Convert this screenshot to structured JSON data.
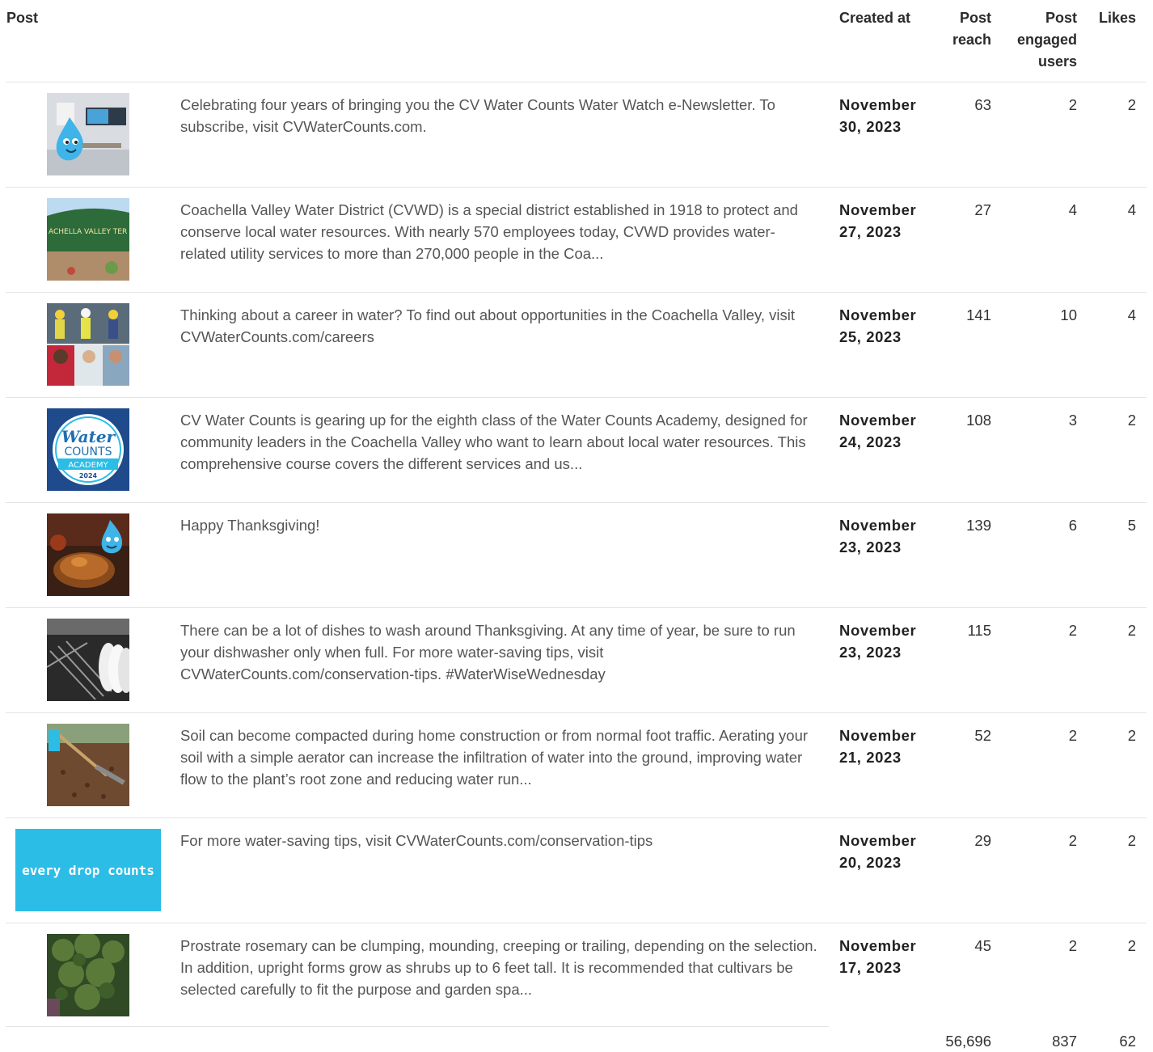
{
  "headers": {
    "post": "Post",
    "created_at": "Created at",
    "post_reach": "Post reach",
    "post_engaged_users": "Post engaged users",
    "likes": "Likes"
  },
  "rows": [
    {
      "thumb_icon": "water-drop-mascot-office-icon",
      "text": "Celebrating four years of bringing you the CV Water Counts Water Watch e-Newsletter. To subscribe, visit CVWaterCounts.com.",
      "date": "November 30, 2023",
      "reach": "63",
      "engaged": "2",
      "likes": "2"
    },
    {
      "thumb_icon": "district-sign-icon",
      "thumb_text": "ACHELLA VALLEY TER DISTRICT",
      "text": "Coachella Valley Water District (CVWD) is a special district established in 1918 to protect and conserve local water resources. With nearly 570 employees today, CVWD provides water-related utility services to more than 270,000 people in the Coa...",
      "date": "November 27, 2023",
      "reach": "27",
      "engaged": "4",
      "likes": "4"
    },
    {
      "thumb_icon": "workers-collage-icon",
      "text": "Thinking about a career in water? To find out about opportunities in the Coachella Valley, visit CVWaterCounts.com/careers",
      "date": "November 25, 2023",
      "reach": "141",
      "engaged": "10",
      "likes": "4"
    },
    {
      "thumb_icon": "water-counts-academy-logo-icon",
      "thumb_text": {
        "line1": "Water",
        "line2": "COUNTS",
        "line3": "ACADEMY",
        "line4": "2024"
      },
      "text": "CV Water Counts is gearing up for the eighth class of the Water Counts Academy, designed for community leaders in the Coachella Valley who want to learn about local water resources. This comprehensive course covers the different services and us...",
      "date": "November 24, 2023",
      "reach": "108",
      "engaged": "3",
      "likes": "2"
    },
    {
      "thumb_icon": "thanksgiving-turkey-icon",
      "text": "Happy Thanksgiving!",
      "date": "November 23, 2023",
      "reach": "139",
      "engaged": "6",
      "likes": "5"
    },
    {
      "thumb_icon": "dishwasher-icon",
      "text": "There can be a lot of dishes to wash around Thanksgiving. At any time of year, be sure to run your dishwasher only when full. For more water-saving tips, visit CVWaterCounts.com/conservation-tips. #WaterWiseWednesday",
      "date": "November 23, 2023",
      "reach": "115",
      "engaged": "2",
      "likes": "2"
    },
    {
      "thumb_icon": "soil-aerator-rake-icon",
      "text": "Soil can become compacted during home construction or from normal foot traffic. Aerating your soil with a simple aerator can increase the infiltration of water into the ground, improving water flow to the plant’s root zone and reducing water run...",
      "date": "November 21, 2023",
      "reach": "52",
      "engaged": "2",
      "likes": "2"
    },
    {
      "thumb_icon": "every-drop-counts-banner-icon",
      "thumb_text": "every drop counts",
      "text": "For more water-saving tips, visit CVWaterCounts.com/conservation-tips",
      "date": "November 20, 2023",
      "reach": "29",
      "engaged": "2",
      "likes": "2"
    },
    {
      "thumb_icon": "rosemary-plant-icon",
      "text": "Prostrate rosemary can be clumping, mounding, creeping or trailing, depending on the selection. In addition, upright forms grow as shrubs up to 6 feet tall. It is recommended that cultivars be selected carefully to fit the purpose and garden spa...",
      "date": "November 17, 2023",
      "reach": "45",
      "engaged": "2",
      "likes": "2"
    }
  ],
  "totals": {
    "reach": "56,696",
    "engaged": "837",
    "likes": "62"
  },
  "colors": {
    "brand_blue": "#2bbde6",
    "academy_navy": "#1f4a8c",
    "header_text": "#2b2b2b",
    "body_text": "#555555",
    "divider": "#e4e4e4"
  }
}
